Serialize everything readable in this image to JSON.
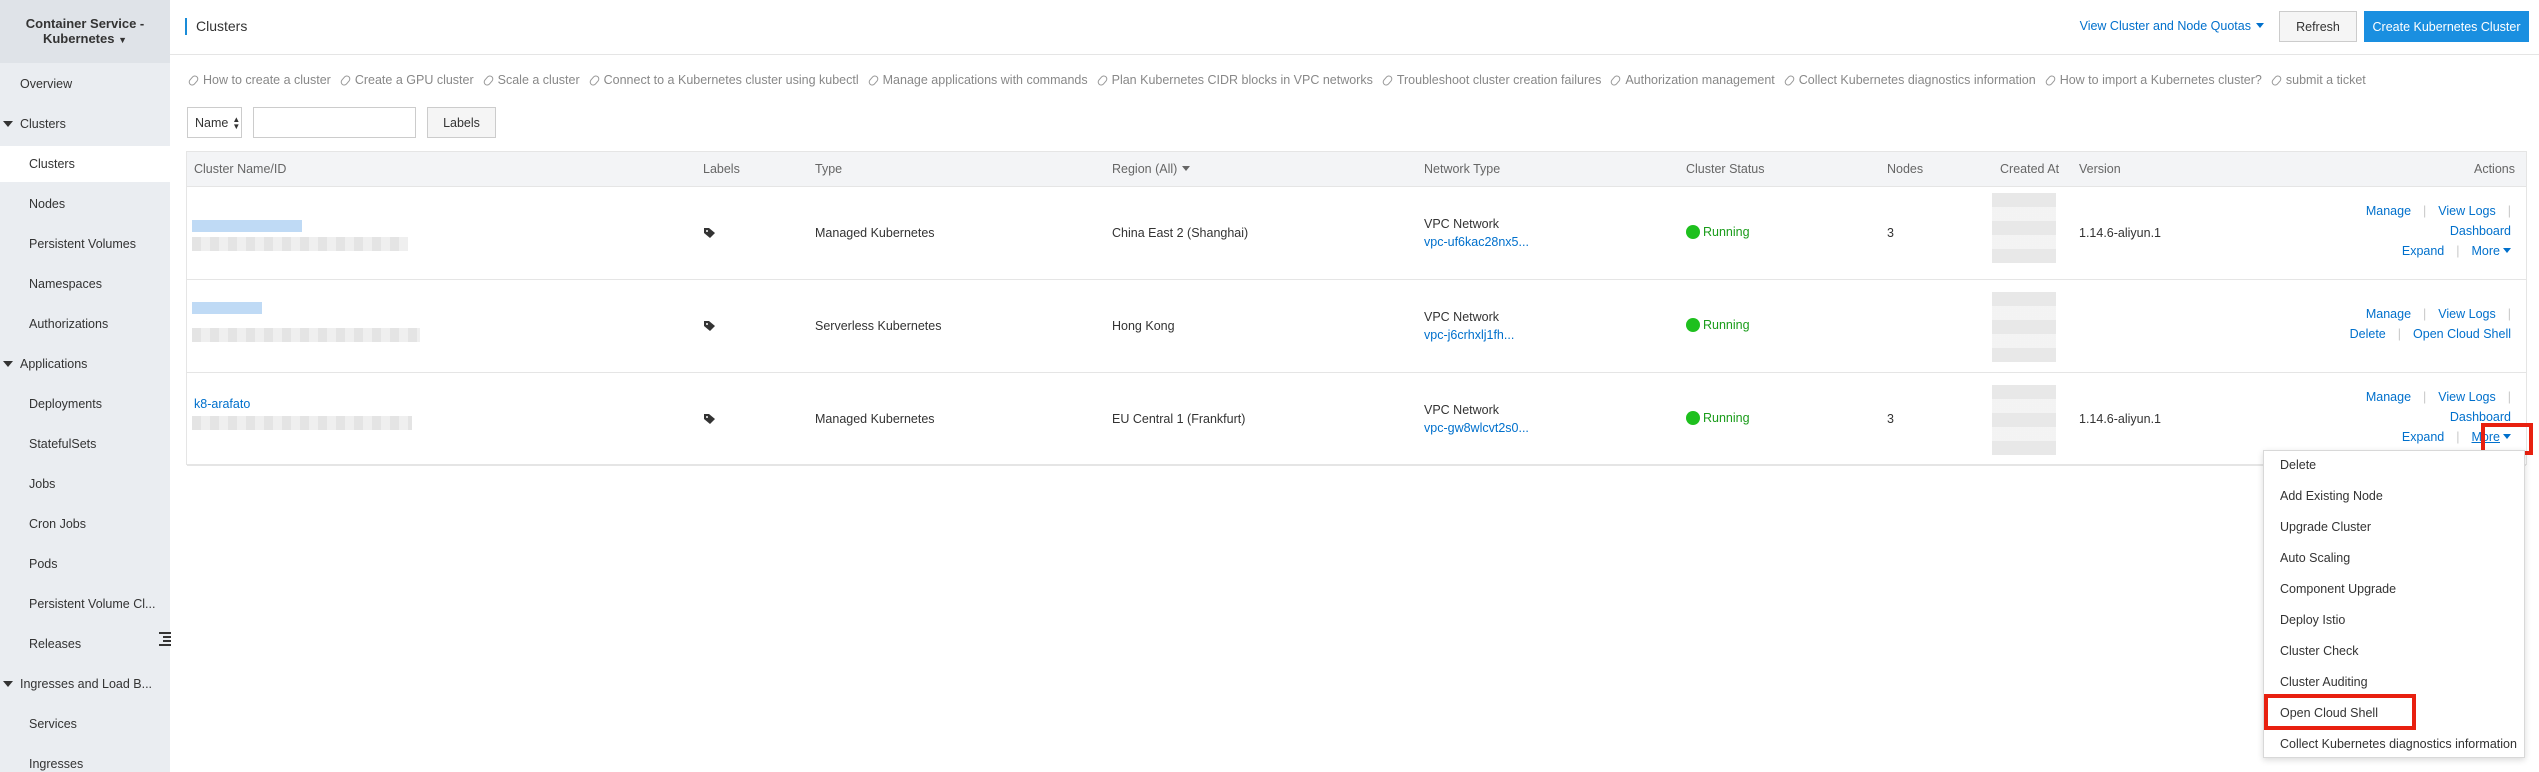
{
  "sidebar": {
    "app_title_line1": "Container Service -",
    "app_title_line2": "Kubernetes",
    "items": [
      {
        "label": "Overview"
      },
      {
        "label": "Clusters"
      },
      {
        "label": "Clusters"
      },
      {
        "label": "Nodes"
      },
      {
        "label": "Persistent Volumes"
      },
      {
        "label": "Namespaces"
      },
      {
        "label": "Authorizations"
      },
      {
        "label": "Applications"
      },
      {
        "label": "Deployments"
      },
      {
        "label": "StatefulSets"
      },
      {
        "label": "Jobs"
      },
      {
        "label": "Cron Jobs"
      },
      {
        "label": "Pods"
      },
      {
        "label": "Persistent Volume Cl..."
      },
      {
        "label": "Releases"
      },
      {
        "label": "Ingresses and Load B..."
      },
      {
        "label": "Services"
      },
      {
        "label": "Ingresses"
      }
    ]
  },
  "header": {
    "title": "Clusters",
    "quota_link": "View Cluster and Node Quotas",
    "refresh": "Refresh",
    "create": "Create Kubernetes Cluster"
  },
  "help_links": [
    "How to create a cluster",
    "Create a GPU cluster",
    "Scale a cluster",
    "Connect to a Kubernetes cluster using kubectl",
    "Manage applications with commands",
    "Plan Kubernetes CIDR blocks in VPC networks",
    "Troubleshoot cluster creation failures",
    "Authorization management",
    "Collect Kubernetes diagnostics information",
    "How to import a Kubernetes cluster?",
    "submit a ticket"
  ],
  "filter": {
    "select_value": "Name",
    "search_placeholder": "",
    "labels_button": "Labels"
  },
  "table": {
    "headers": {
      "name": "Cluster Name/ID",
      "labels": "Labels",
      "type": "Type",
      "region": "Region (All)",
      "network": "Network Type",
      "status": "Cluster Status",
      "nodes": "Nodes",
      "created": "Created At",
      "version": "Version",
      "actions": "Actions"
    },
    "rows": [
      {
        "name": "",
        "type": "Managed Kubernetes",
        "region": "China East 2 (Shanghai)",
        "network": "VPC Network",
        "vpc": "vpc-uf6kac28nx5...",
        "status": "Running",
        "nodes": "3",
        "version": "1.14.6-aliyun.1",
        "actions": {
          "manage": "Manage",
          "logs": "View Logs",
          "dashboard": "Dashboard",
          "expand": "Expand",
          "more": "More"
        }
      },
      {
        "name": "",
        "type": "Serverless Kubernetes",
        "region": "Hong Kong",
        "network": "VPC Network",
        "vpc": "vpc-j6crhxlj1fh...",
        "status": "Running",
        "nodes": "",
        "version": "",
        "actions": {
          "manage": "Manage",
          "logs": "View Logs",
          "delete": "Delete",
          "shell": "Open Cloud Shell"
        }
      },
      {
        "name": "k8-arafato",
        "type": "Managed Kubernetes",
        "region": "EU Central 1 (Frankfurt)",
        "network": "VPC Network",
        "vpc": "vpc-gw8wlcvt2s0...",
        "status": "Running",
        "nodes": "3",
        "version": "1.14.6-aliyun.1",
        "actions": {
          "manage": "Manage",
          "logs": "View Logs",
          "dashboard": "Dashboard",
          "expand": "Expand",
          "more": "More"
        }
      }
    ]
  },
  "more_menu": {
    "items": [
      "Delete",
      "Add Existing Node",
      "Upgrade Cluster",
      "Auto Scaling",
      "Component Upgrade",
      "Deploy Istio",
      "Cluster Check",
      "Cluster Auditing",
      "Open Cloud Shell",
      "Collect Kubernetes diagnostics information"
    ]
  },
  "colors": {
    "accent": "#1a8fe0",
    "link": "#0070cc",
    "running": "#1ec01e",
    "highlight": "#e8200f"
  }
}
